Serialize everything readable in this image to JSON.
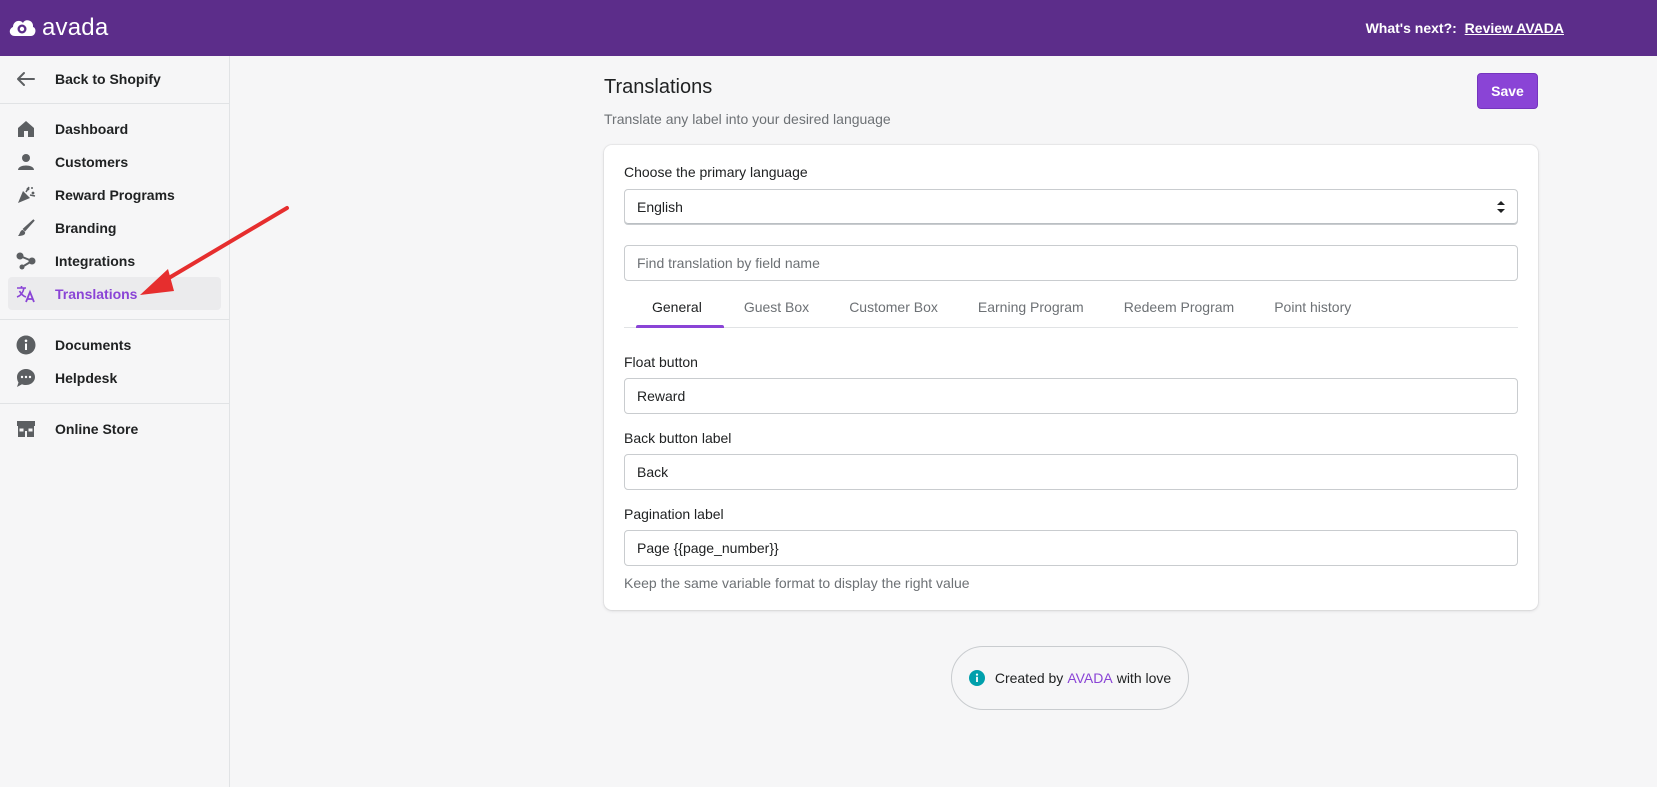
{
  "header": {
    "logo_text": "avada",
    "whats_next_label": "What's next?:",
    "whats_next_link": "Review AVADA"
  },
  "sidebar": {
    "back": "Back to Shopify",
    "items": [
      {
        "label": "Dashboard",
        "icon": "home-icon"
      },
      {
        "label": "Customers",
        "icon": "person-icon"
      },
      {
        "label": "Reward Programs",
        "icon": "confetti-icon"
      },
      {
        "label": "Branding",
        "icon": "paintbrush-icon"
      },
      {
        "label": "Integrations",
        "icon": "integration-icon"
      },
      {
        "label": "Translations",
        "icon": "translate-icon",
        "active": true
      }
    ],
    "secondary": [
      {
        "label": "Documents",
        "icon": "info-icon"
      },
      {
        "label": "Helpdesk",
        "icon": "chat-icon"
      }
    ],
    "store": {
      "label": "Online Store",
      "icon": "store-icon"
    }
  },
  "page": {
    "title": "Translations",
    "subtitle": "Translate any label into your desired language",
    "save_label": "Save"
  },
  "card": {
    "language_label": "Choose the primary language",
    "language_value": "English",
    "search_placeholder": "Find translation by field name",
    "tabs": [
      "General",
      "Guest Box",
      "Customer Box",
      "Earning Program",
      "Redeem Program",
      "Point history"
    ],
    "active_tab": "General",
    "fields": [
      {
        "label": "Float button",
        "value": "Reward"
      },
      {
        "label": "Back button label",
        "value": "Back"
      },
      {
        "label": "Pagination label",
        "value": "Page {{page_number}}"
      }
    ],
    "help_text": "Keep the same variable format to display the right value"
  },
  "footer": {
    "prefix": "Created by",
    "brand": "AVADA",
    "suffix": "with love"
  },
  "colors": {
    "header_bg": "#5c2d8a",
    "accent": "#8a44d6",
    "annotation_arrow": "#e62e2e"
  }
}
